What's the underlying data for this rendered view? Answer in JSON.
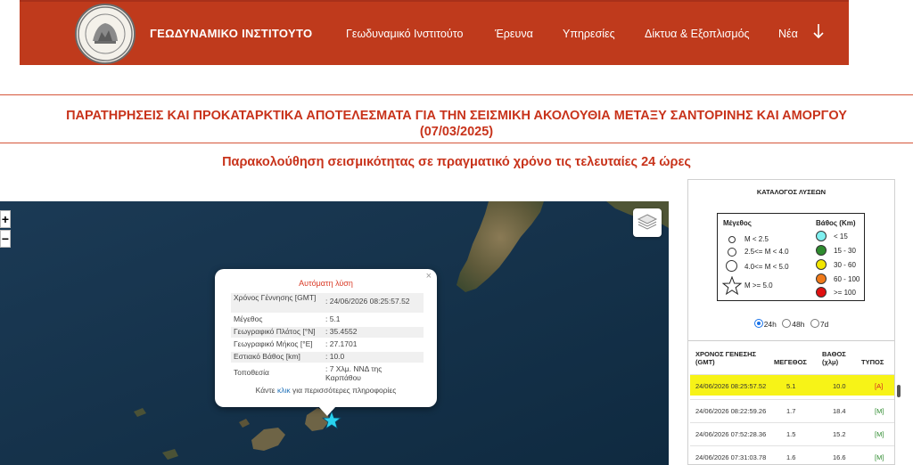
{
  "header": {
    "site_title": "ΓΕΩΔΥΝΑΜΙΚΟ ΙΝΣΤΙΤΟΥΤΟ",
    "nav": [
      {
        "label": "Γεωδυναμικό Ινστιτούτο"
      },
      {
        "label": "Έρευνα"
      },
      {
        "label": "Υπηρεσίες"
      },
      {
        "label": "Δίκτυα & Εξοπλισμός"
      },
      {
        "label": "Νέα"
      }
    ],
    "nav_more_icon": "arrow-down-icon",
    "colors": {
      "bar": "#bf3a1c",
      "text": "#ffffff"
    }
  },
  "page": {
    "title_line1": "ΠΑΡΑΤΗΡΗΣΕΙΣ ΚΑΙ ΠΡΟΚΑΤΑΡΚΤΙΚΑ ΑΠΟΤΕΛΕΣΜΑΤΑ ΓΙΑ ΤΗΝ ΣΕΙΣΜΙΚΗ ΑΚΟΛΟΥΘΙΑ ΜΕΤΑΞΥ ΣΑΝΤΟΡΙΝΗΣ ΚΑΙ ΑΜΟΡΓΟΥ",
    "title_line2": "(07/03/2025)",
    "subtitle": "Παρακολούθηση σεισμικότητας σε πραγματικό χρόνο τις τελευταίες 24 ώρες",
    "accent_color": "#c8331b"
  },
  "map": {
    "zoom_in": "+",
    "zoom_out": "−",
    "layers_icon": "layers-icon",
    "popup": {
      "title": "Αυτόματη λύση",
      "close": "×",
      "rows": [
        {
          "key": "Χρόνος Γέννησης [GMT]",
          "value": ": 24/06/2026 08:25:57.52"
        },
        {
          "key": "Μέγεθος",
          "value": ": 5.1"
        },
        {
          "key": "Γεωγραφικό Πλάτος [°N]",
          "value": ": 35.4552"
        },
        {
          "key": "Γεωγραφικό Μήκος [°E]",
          "value": ": 27.1701"
        },
        {
          "key": "Εστιακό Βάθος [km]",
          "value": ": 10.0"
        },
        {
          "key": "Τοποθεσία",
          "value": ": 7 Χλμ. ΝΝΔ της Καρπάθου"
        }
      ],
      "more_prefix": "Κάντε",
      "more_link": "κλικ",
      "more_suffix": "για περισσότερες πληροφορίες"
    },
    "event_marker_icon": "star-icon",
    "event_marker_color": "#29d3f0"
  },
  "panel": {
    "title": "ΚΑΤΑΛΟΓΟΣ ΛΥΣΕΩΝ",
    "legend": {
      "magnitude_head": "Μέγεθος",
      "depth_head": "Βάθος (Km)",
      "magnitudes": [
        {
          "label": "M < 2.5"
        },
        {
          "label": "2.5<= M < 4.0"
        },
        {
          "label": "4.0<= M < 5.0"
        },
        {
          "label": "M >= 5.0"
        }
      ],
      "depths": [
        {
          "label": "< 15",
          "color": "#7ff0f0"
        },
        {
          "label": "15 - 30",
          "color": "#2e8b2e"
        },
        {
          "label": "30 - 60",
          "color": "#f2e600"
        },
        {
          "label": "60 - 100",
          "color": "#f07a1a"
        },
        {
          "label": ">= 100",
          "color": "#e01010"
        }
      ]
    },
    "ranges": [
      {
        "label": "24h",
        "selected": true
      },
      {
        "label": "48h",
        "selected": false
      },
      {
        "label": "7d",
        "selected": false
      }
    ],
    "table": {
      "headers": {
        "time": "ΧΡΟΝΟΣ ΓΕΝΕΣΗΣ (GMT)",
        "mag": "ΜΕΓΕΘΟΣ",
        "depth": "ΒΑΘΟΣ (χλμ)",
        "type": "ΤΥΠΟΣ"
      },
      "rows": [
        {
          "time": "24/06/2026 08:25:57.52",
          "mag": "5.1",
          "depth": "10.0",
          "type": "[A]",
          "type_color": "#d22222"
        },
        {
          "time": "24/06/2026 08:22:59.26",
          "mag": "1.7",
          "depth": "18.4",
          "type": "[M]",
          "type_color": "#2e8b2e"
        },
        {
          "time": "24/06/2026 07:52:28.36",
          "mag": "1.5",
          "depth": "15.2",
          "type": "[M]",
          "type_color": "#2e8b2e"
        },
        {
          "time": "24/06/2026 07:31:03.78",
          "mag": "1.6",
          "depth": "16.6",
          "type": "[M]",
          "type_color": "#2e8b2e"
        }
      ]
    }
  }
}
